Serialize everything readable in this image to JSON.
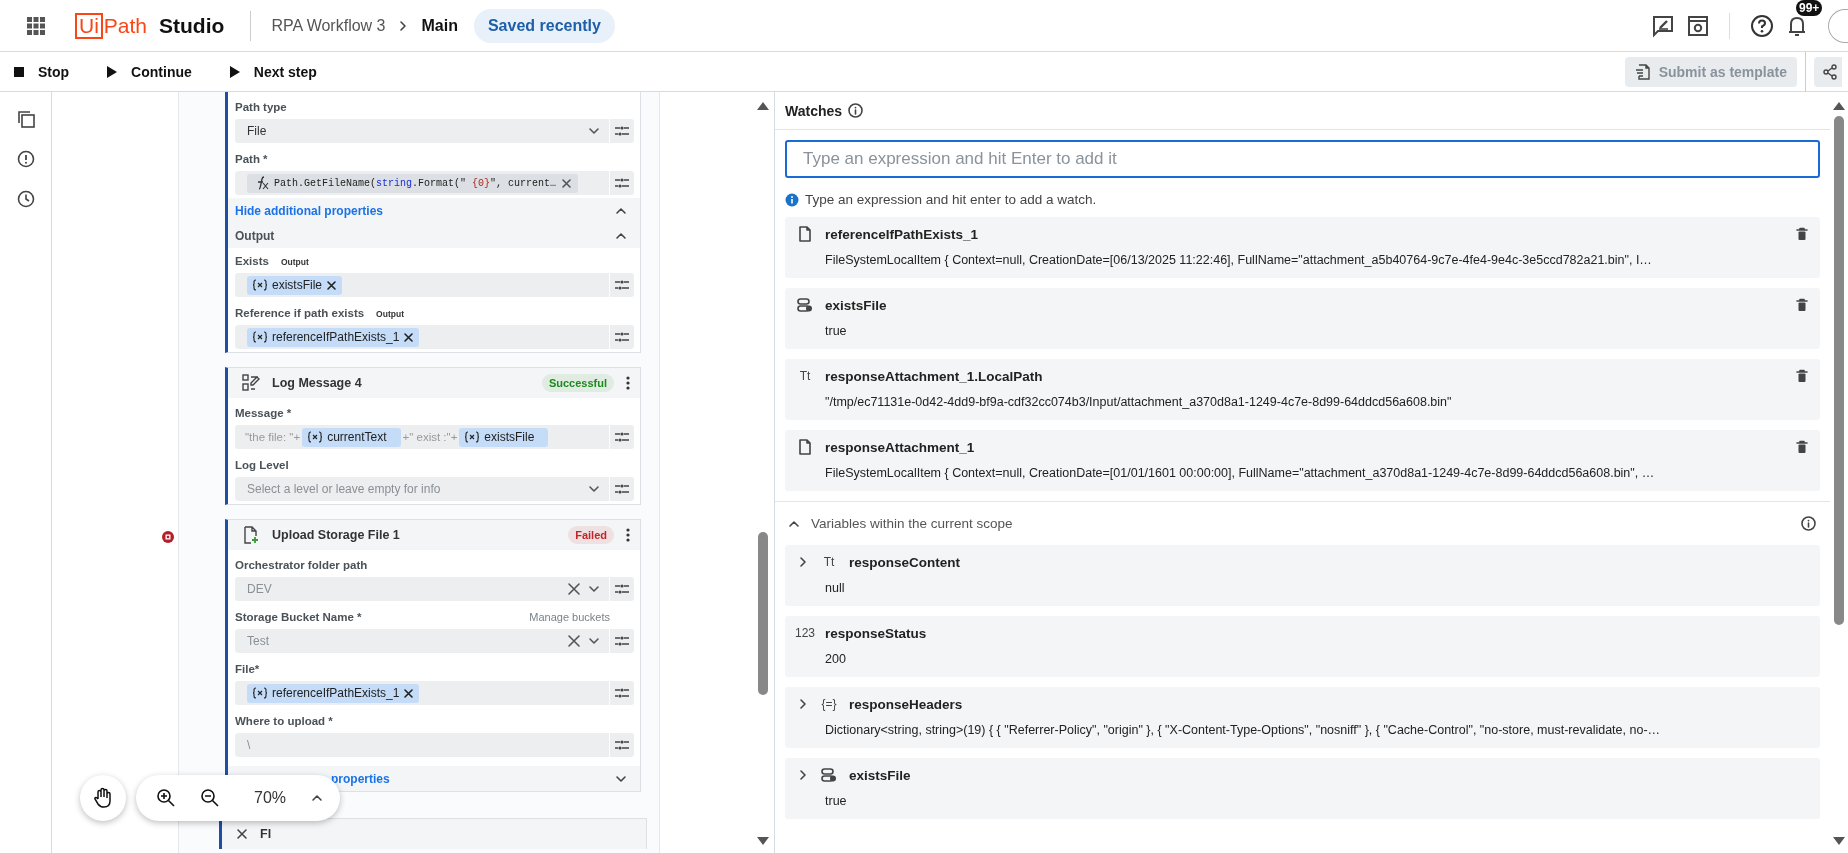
{
  "app_bar": {
    "logo_box": "Ui",
    "logo_rest": "Path",
    "product": "Studio",
    "breadcrumb": [
      "RPA Workflow 3",
      "Main"
    ],
    "save_status": "Saved recently",
    "notification_count": "99+"
  },
  "debug_toolbar": {
    "buttons": [
      {
        "kind": "stop",
        "label": "Stop"
      },
      {
        "kind": "play",
        "label": "Continue"
      },
      {
        "kind": "play",
        "label": "Next step"
      }
    ],
    "submit_button": {
      "label": "Submit as template",
      "disabled": true
    }
  },
  "canvas": {
    "cards": [
      {
        "kind": "partial",
        "rows": [
          {
            "kind": "dropdown",
            "label": "Path type",
            "value": "File"
          },
          {
            "kind": "expression",
            "label": "Path *",
            "segments": [
              {
                "kind": "plain",
                "text": "Path.GetFileName("
              },
              {
                "kind": "keyword",
                "text": "string"
              },
              {
                "kind": "plain",
                "text": ".Format(\""
              },
              {
                "kind": "string",
                "text": " {0}"
              },
              {
                "kind": "plain",
                "text": "\", current…"
              }
            ]
          },
          {
            "kind": "link_row",
            "label": "Hide additional properties",
            "expanded": true
          },
          {
            "kind": "section",
            "label": "Output",
            "expanded": true
          },
          {
            "kind": "variable",
            "label": "Exists",
            "tag": "Output",
            "chips": [
              {
                "text": "existsFile",
                "removable": true
              }
            ]
          },
          {
            "kind": "variable",
            "label": "Reference if path exists",
            "tag": "Output",
            "chips": [
              {
                "text": "referenceIfPathExists_1",
                "removable": true
              }
            ]
          }
        ]
      },
      {
        "kind": "log",
        "title": "Log Message 4",
        "status": {
          "text": "Successful",
          "color": "#1d8a1d"
        },
        "rows": [
          {
            "kind": "mixed",
            "label": "Message *",
            "tokens": [
              {
                "kind": "text",
                "text": "\"the file: \"+"
              },
              {
                "kind": "var",
                "text": "currentText"
              },
              {
                "kind": "text",
                "text": "+\" exist :\"+"
              },
              {
                "kind": "var",
                "text": "existsFile"
              }
            ]
          },
          {
            "kind": "dropdown",
            "label": "Log Level",
            "placeholder": "Select a level or leave empty for info"
          }
        ]
      },
      {
        "kind": "upload",
        "title": "Upload Storage File 1",
        "status": {
          "text": "Failed",
          "color": "#c0252a"
        },
        "breakpoint": true,
        "rows": [
          {
            "kind": "dropdown",
            "label": "Orchestrator folder path",
            "value": "DEV",
            "disabled": true,
            "clearable": true
          },
          {
            "kind": "dropdown",
            "label": "Storage Bucket Name *",
            "side_link": "Manage buckets",
            "value": "Test",
            "disabled": true,
            "clearable": true
          },
          {
            "kind": "variable",
            "label": "File*",
            "chips": [
              {
                "text": "referenceIfPathExists_1",
                "removable": true
              }
            ]
          },
          {
            "kind": "text",
            "label": "Where to upload *",
            "value": "\\",
            "disabled": true
          },
          {
            "kind": "footer_link",
            "label": "properties",
            "expanded": false
          }
        ]
      },
      {
        "kind": "collapsed",
        "title": "Fl"
      }
    ],
    "zoom_level": "70%"
  },
  "watches": {
    "title": "Watches",
    "input": {
      "placeholder": "Type an expression and hit Enter to add it",
      "focused": true
    },
    "hint": "Type an expression and hit enter to add a watch.",
    "items": [
      {
        "kind": "file",
        "name": "referenceIfPathExists_1",
        "value": "FileSystemLocalItem { Context=null, CreationDate=[06/13/2025 11:22:46], FullName=\"attachment_a5b40764-9c7e-4fe4-9e4c-3e5ccd782a21.bin\", I…"
      },
      {
        "kind": "boolean",
        "name": "existsFile",
        "value": "true"
      },
      {
        "kind": "text",
        "glyph": "Tt",
        "name": "responseAttachment_1.LocalPath",
        "value": "\"/tmp/ec71131e-0d42-4dd9-bf9a-cdf32cc074b3/Input/attachment_a370d8a1-1249-4c7e-8d99-64ddcd56a608.bin\""
      },
      {
        "kind": "file",
        "name": "responseAttachment_1",
        "value": "FileSystemLocalItem { Context=null, CreationDate=[01/01/1601 00:00:00], FullName=\"attachment_a370d8a1-1249-4c7e-8d99-64ddcd56a608.bin\", …"
      }
    ]
  },
  "variables": {
    "title": "Variables within the current scope",
    "expanded": true,
    "items": [
      {
        "kind": "text",
        "glyph": "Tt",
        "name": "responseContent",
        "value": "null",
        "expandable": true
      },
      {
        "kind": "number",
        "glyph": "123",
        "name": "responseStatus",
        "value": "200",
        "expandable": false
      },
      {
        "kind": "object",
        "glyph": "{=}",
        "name": "responseHeaders",
        "value": "Dictionary<string, string>(19) { { \"Referrer-Policy\", \"origin\" }, { \"X-Content-Type-Options\", \"nosniff\" }, { \"Cache-Control\", \"no-store, must-revalidate, no-…",
        "expandable": true
      },
      {
        "kind": "boolean",
        "name": "existsFile",
        "value": "true",
        "expandable": true
      }
    ]
  }
}
